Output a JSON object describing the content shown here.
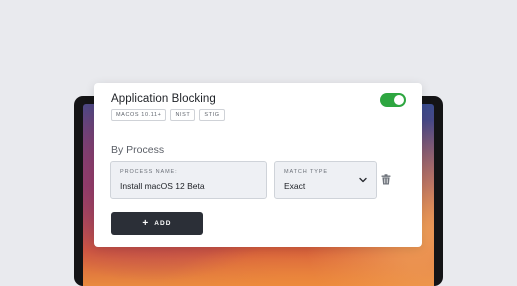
{
  "policy": {
    "title": "Application Blocking",
    "enabled": true,
    "tags": [
      "MACOS 10.11+",
      "NIST",
      "STIG"
    ]
  },
  "section": {
    "title": "By Process"
  },
  "process_name": {
    "label": "PROCESS NAME:",
    "value": "Install macOS 12 Beta"
  },
  "match_type": {
    "label": "MATCH TYPE",
    "value": "Exact"
  },
  "add_button": {
    "icon": "+",
    "label": "ADD"
  },
  "icons": {
    "toggle": "toggle-switch",
    "chevron": "chevron-down-icon",
    "trash": "trash-icon",
    "plus": "plus-icon"
  },
  "colors": {
    "toggle_on": "#2ea640",
    "button": "#2b2f37",
    "field_bg": "#eef0f4"
  }
}
